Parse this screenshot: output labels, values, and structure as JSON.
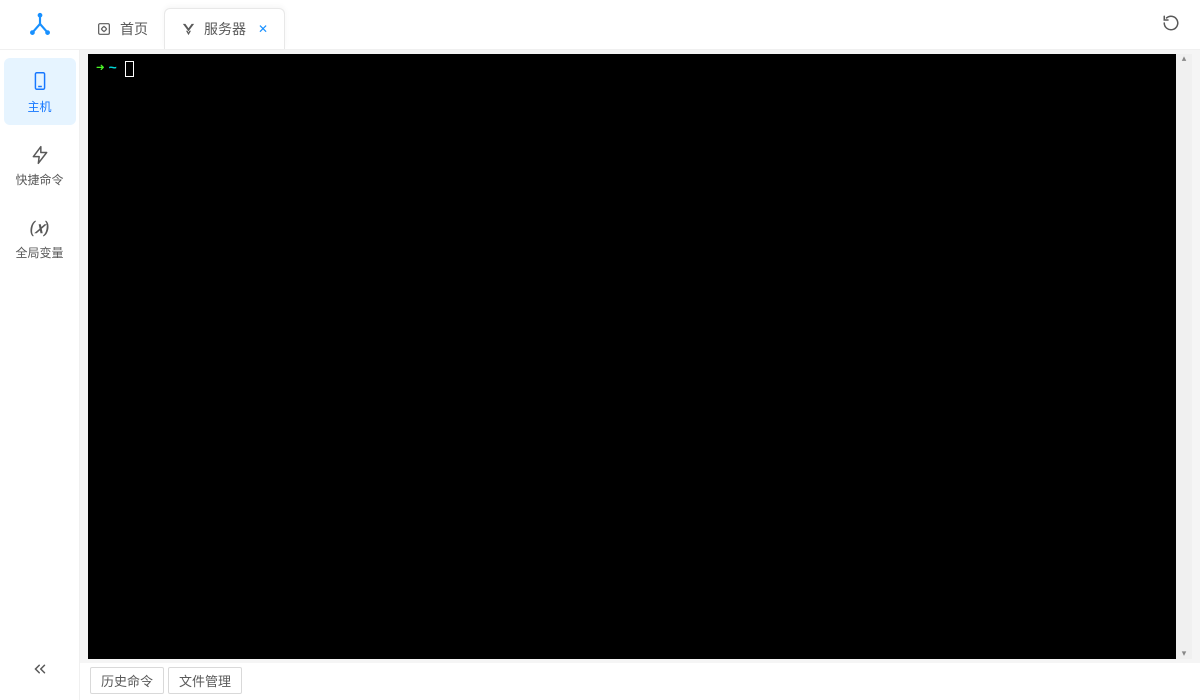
{
  "tabs": [
    {
      "label": "首页",
      "icon": "home-icon",
      "active": false,
      "closable": false
    },
    {
      "label": "服务器",
      "icon": "server-v-icon",
      "active": true,
      "closable": true
    }
  ],
  "sidebar": {
    "items": [
      {
        "label": "主机",
        "icon": "host-icon",
        "active": true
      },
      {
        "label": "快捷命令",
        "icon": "bolt-icon",
        "active": false
      },
      {
        "label": "全局变量",
        "icon": "variable-icon",
        "active": false
      }
    ]
  },
  "terminal": {
    "prompt_arrow": "➜",
    "prompt_path": "~"
  },
  "bottom_tabs": [
    {
      "label": "历史命令"
    },
    {
      "label": "文件管理"
    }
  ]
}
